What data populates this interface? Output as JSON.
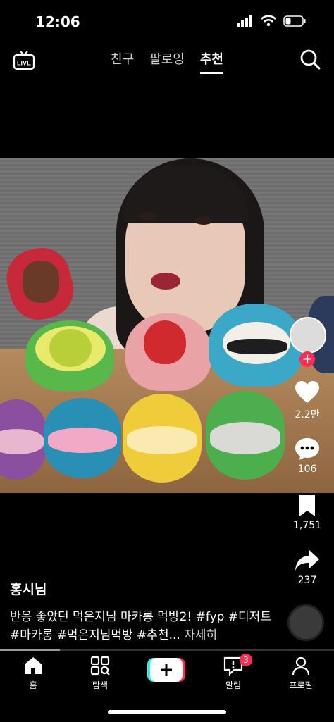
{
  "status": {
    "time": "12:06"
  },
  "top_nav": {
    "live_label": "LIVE",
    "tabs": [
      {
        "label": "친구",
        "active": false
      },
      {
        "label": "팔로잉",
        "active": false
      },
      {
        "label": "추천",
        "active": true
      }
    ]
  },
  "actions": {
    "likes": "2.2만",
    "comments": "106",
    "saves": "1,751",
    "shares": "237"
  },
  "post": {
    "username": "홍시님",
    "description": "반응 좋았던 먹은지님 마카롱 먹방2! #fyp #디저트 #마카롱 #먹은지님먹방 #추천...",
    "more_label": "자세히"
  },
  "playback": {
    "progress": 0.18
  },
  "bottom_nav": {
    "items": [
      {
        "label": "홈",
        "icon": "home-icon"
      },
      {
        "label": "탐색",
        "icon": "explore-icon"
      },
      {
        "label": "",
        "icon": "create-plus-icon"
      },
      {
        "label": "알림",
        "icon": "inbox-icon"
      },
      {
        "label": "프로필",
        "icon": "profile-icon"
      }
    ],
    "inbox_badge": "3"
  },
  "colors": {
    "accent": "#fe2c55",
    "cyan": "#25f4ee"
  }
}
